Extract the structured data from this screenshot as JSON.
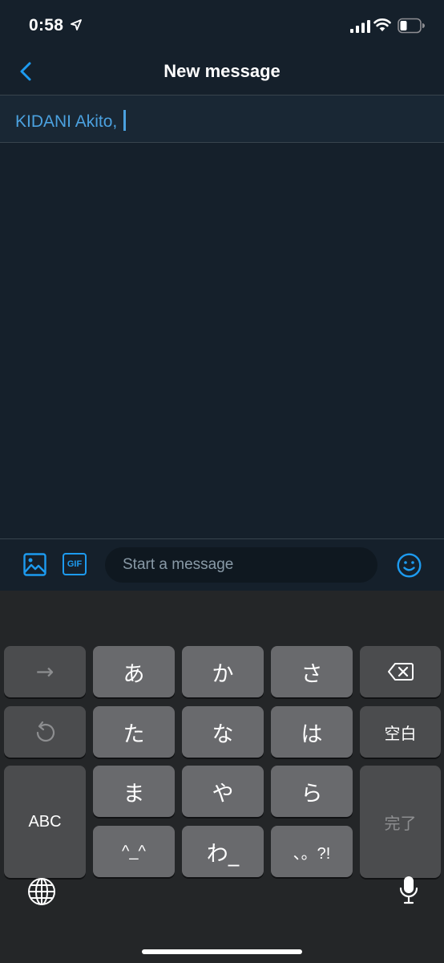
{
  "status_bar": {
    "time": "0:58"
  },
  "nav": {
    "title": "New message"
  },
  "recipients": {
    "text": "KIDANI Akito,"
  },
  "composer": {
    "placeholder": "Start a message",
    "gif_label": "GIF"
  },
  "keyboard": {
    "keys": {
      "next": "→",
      "a": "あ",
      "ka": "か",
      "sa": "さ",
      "ta": "た",
      "na": "な",
      "ha": "は",
      "space": "空白",
      "abc": "ABC",
      "ma": "ま",
      "ya": "や",
      "ra": "ら",
      "kaomoji": "^_^",
      "wa": "わ_",
      "punct": "、。?!",
      "done": "完了"
    }
  },
  "colors": {
    "background": "#15202b",
    "accent": "#1d9bf0",
    "recipient_text": "#4ba1df",
    "keyboard_bg": "#242628"
  },
  "icons": [
    "location-arrow-icon",
    "signal-icon",
    "wifi-icon",
    "battery-icon",
    "back-chevron-icon",
    "image-icon",
    "gif-icon",
    "emoji-icon",
    "backspace-icon",
    "undo-icon",
    "globe-icon",
    "microphone-icon"
  ]
}
